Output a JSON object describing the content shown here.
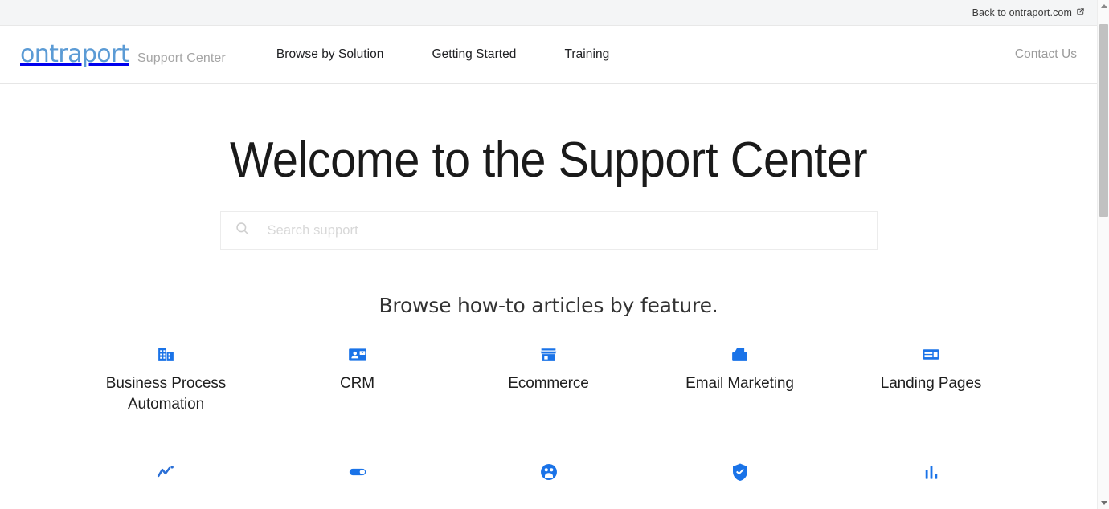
{
  "topbar": {
    "link_label": "Back to ontraport.com",
    "link_icon": "external-link-icon"
  },
  "header": {
    "logo_text": "ontraport",
    "logo_subtitle": "Support Center",
    "nav": [
      {
        "label": "Browse by Solution"
      },
      {
        "label": "Getting Started"
      },
      {
        "label": "Training"
      }
    ],
    "contact_label": "Contact Us"
  },
  "hero": {
    "title": "Welcome to the Support Center",
    "search": {
      "icon": "search-icon",
      "placeholder": "Search support",
      "value": ""
    }
  },
  "browse": {
    "section_title": "Browse how-to articles by feature.",
    "features": [
      {
        "label": "Business Process Automation",
        "icon": "office-building-icon"
      },
      {
        "label": "CRM",
        "icon": "contact-card-icon"
      },
      {
        "label": "Ecommerce",
        "icon": "storefront-icon"
      },
      {
        "label": "Email Marketing",
        "icon": "mail-outbox-icon"
      },
      {
        "label": "Landing Pages",
        "icon": "page-layout-icon"
      },
      {
        "label": "",
        "icon": "trending-line-chart-icon"
      },
      {
        "label": "",
        "icon": "toggle-switch-icon"
      },
      {
        "label": "",
        "icon": "people-group-icon"
      },
      {
        "label": "",
        "icon": "shield-check-icon"
      },
      {
        "label": "",
        "icon": "bar-chart-icon"
      }
    ]
  },
  "scrollbar": {
    "up_icon": "scroll-up-arrow-icon",
    "down_icon": "scroll-down-arrow-icon"
  },
  "colors": {
    "icon_blue": "#1a73e8",
    "logo_blue": "#5b9bd5",
    "topbar_bg": "#f4f5f6"
  }
}
